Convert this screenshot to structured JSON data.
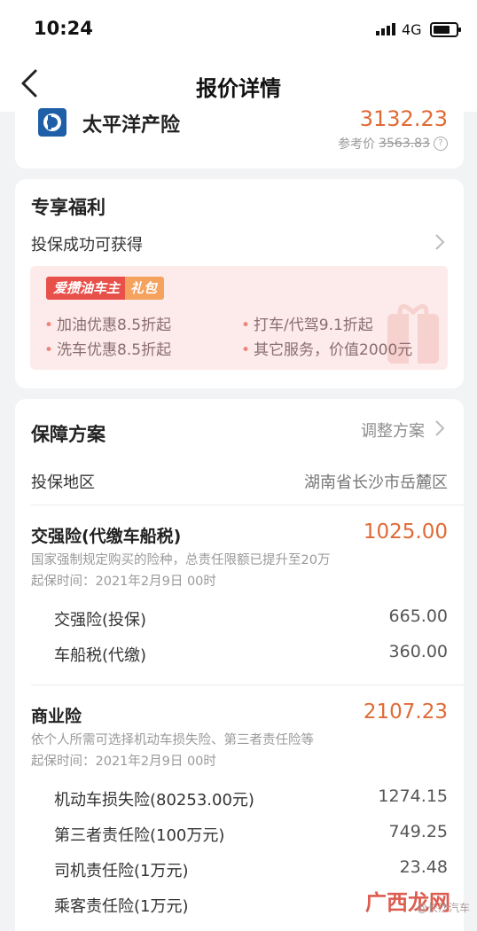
{
  "status": {
    "time": "10:24",
    "network": "4G"
  },
  "nav": {
    "title": "报价详情"
  },
  "quote": {
    "insurer": "太平洋产险",
    "price": "3132.23",
    "ref_label": "参考价",
    "ref_price": "3563.83"
  },
  "benefits": {
    "title": "专享福利",
    "subtitle": "投保成功可获得",
    "tag_main": "爱攒油车主",
    "tag_sub": "礼包",
    "items": [
      "加油优惠8.5折起",
      "打车/代驾9.1折起",
      "洗车优惠8.5折起",
      "其它服务，价值2000元"
    ]
  },
  "plan": {
    "title": "保障方案",
    "adjust": "调整方案",
    "region_label": "投保地区",
    "region_value": "湖南省长沙市岳麓区",
    "compulsory": {
      "title": "交强险(代缴车船税)",
      "amount": "1025.00",
      "note1": "国家强制规定购买的险种，总责任限额已提升至20万",
      "note2": "起保时间：2021年2月9日 00时",
      "items": [
        {
          "label": "交强险(投保)",
          "value": "665.00"
        },
        {
          "label": "车船税(代缴)",
          "value": "360.00"
        }
      ]
    },
    "commercial": {
      "title": "商业险",
      "amount": "2107.23",
      "note1": "依个人所需可选择机动车损失险、第三者责任险等",
      "note2": "起保时间：2021年2月9日 00时",
      "items": [
        {
          "label": "机动车损失险(80253.00元)",
          "value": "1274.15"
        },
        {
          "label": "第三者责任险(100万元)",
          "value": "749.25"
        },
        {
          "label": "司机责任险(1万元)",
          "value": "23.48"
        },
        {
          "label": "乘客责任险(1万元)",
          "value": ""
        }
      ]
    }
  },
  "watermark": {
    "text": "广西龙网",
    "sub": "@长沙汽车"
  },
  "colors": {
    "accent": "#e06a36",
    "promo_bg": "#fdeaea",
    "tag_red": "#e8504a",
    "tag_orange": "#f4a25e"
  }
}
